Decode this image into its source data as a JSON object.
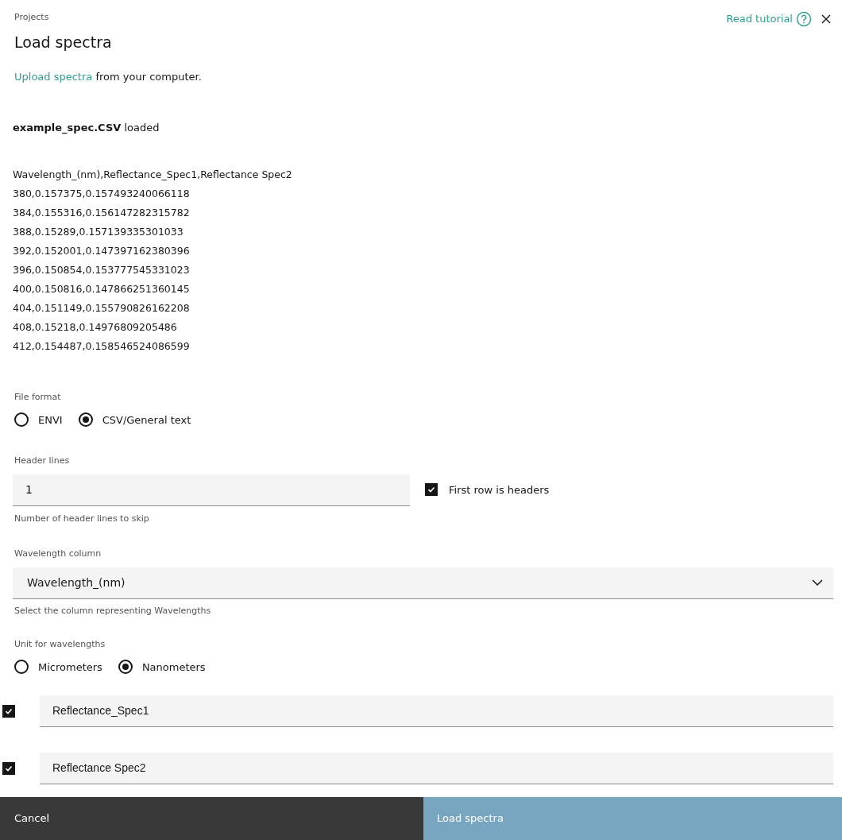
{
  "breadcrumb": "Projects",
  "title": "Load spectra",
  "tutorial_link": "Read tutorial",
  "intro": {
    "link": "Upload spectra",
    "text": "from your computer."
  },
  "loaded_message": "**example_spec.CSV** loaded",
  "preview_lines": [
    "Wavelength_(nm),Reflectance_Spec1,Reflectance Spec2",
    "380,0.157375,0.157493240066118",
    "384,0.155316,0.156147282315782",
    "388,0.15289,0.157139335301033",
    "392,0.152001,0.147397162380396",
    "396,0.150854,0.153777545331023",
    "400,0.150816,0.147866251360145",
    "404,0.151149,0.155790826162208",
    "408,0.15218,0.14976809205486",
    "412,0.154487,0.158546524086599"
  ],
  "file_format": {
    "label": "File format",
    "options": [
      {
        "label": "ENVI",
        "selected": false
      },
      {
        "label": "CSV/General text",
        "selected": true
      }
    ]
  },
  "header_lines": {
    "label": "Header lines",
    "value": "1",
    "helper": "Number of header lines to skip",
    "first_row_checkbox": {
      "label": "First row is headers",
      "checked": true
    }
  },
  "wavelength_column": {
    "label": "Wavelength column",
    "value": "Wavelength_(nm)",
    "helper": "Select the column representing Wavelengths"
  },
  "wavelength_unit": {
    "label": "Unit for wavelengths",
    "options": [
      {
        "label": "Micrometers",
        "selected": false
      },
      {
        "label": "Nanometers",
        "selected": true
      }
    ]
  },
  "spectra": [
    {
      "name": "Reflectance_Spec1",
      "checked": true
    },
    {
      "name": "Reflectance Spec2",
      "checked": true
    }
  ],
  "buttons": {
    "cancel": "Cancel",
    "submit": "Load spectra"
  }
}
